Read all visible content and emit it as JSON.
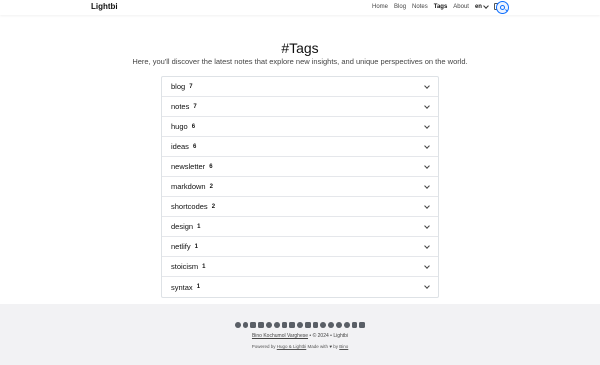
{
  "header": {
    "brand": "Lightbi",
    "nav": [
      "Home",
      "Blog",
      "Notes",
      "Tags",
      "About"
    ],
    "active": "Tags",
    "language": "en"
  },
  "page": {
    "title": "#Tags",
    "subtitle": "Here, you'll discover the latest notes that explore new insights, and unique perspectives on the world."
  },
  "tags": [
    {
      "name": "blog",
      "count": "7"
    },
    {
      "name": "notes",
      "count": "7"
    },
    {
      "name": "hugo",
      "count": "6"
    },
    {
      "name": "ideas",
      "count": "6"
    },
    {
      "name": "newsletter",
      "count": "6"
    },
    {
      "name": "markdown",
      "count": "2"
    },
    {
      "name": "shortcodes",
      "count": "2"
    },
    {
      "name": "design",
      "count": "1"
    },
    {
      "name": "netlify",
      "count": "1"
    },
    {
      "name": "stoicism",
      "count": "1"
    },
    {
      "name": "syntax",
      "count": "1"
    }
  ],
  "footer": {
    "social_icons": [
      "facebook-icon",
      "github-icon",
      "bluesky-icon",
      "x-icon",
      "mastodon-icon",
      "reddit-icon",
      "email-icon",
      "linkedin-icon",
      "threads-icon",
      "instagram-icon",
      "youtube-icon",
      "medium-icon",
      "spotify-icon",
      "pinterest-icon",
      "telegram-icon",
      "snapchat-icon",
      "rss-icon"
    ],
    "author": "Bino Kochumol Varghese",
    "sep1": "•",
    "copyright": "© 2024",
    "sep2": "•",
    "site": "Lightbi",
    "powered_prefix": "Powered by",
    "powered_link": "Hugo & Lightbi",
    "made_with": "Made with",
    "by": "by",
    "author_short": "Bino"
  }
}
